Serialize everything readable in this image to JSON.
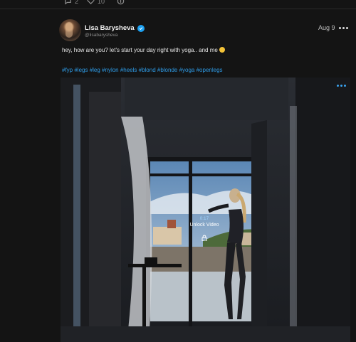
{
  "top_actions": {
    "comments": "2",
    "likes": "10"
  },
  "post": {
    "author_name": "Lisa Barysheva",
    "handle": "@lisabarysheva",
    "date": "Aug 9",
    "text": "hey, how are you? let's start your day right with yoga.. and me",
    "hashtags": "#fyp #legs #leg #nylon #heels #blond #blonde #yoga #openlegs"
  },
  "media": {
    "media_count": "0:17",
    "unlock_label": "Unlock Video"
  },
  "colors": {
    "background": "#141414",
    "hashtag": "#2e9be6",
    "verified": "#1da1f2",
    "accent": "#3aa3ef"
  },
  "icons": [
    "comment-icon",
    "heart-icon",
    "tip-icon",
    "verified-icon",
    "more-icon",
    "lock-icon"
  ]
}
